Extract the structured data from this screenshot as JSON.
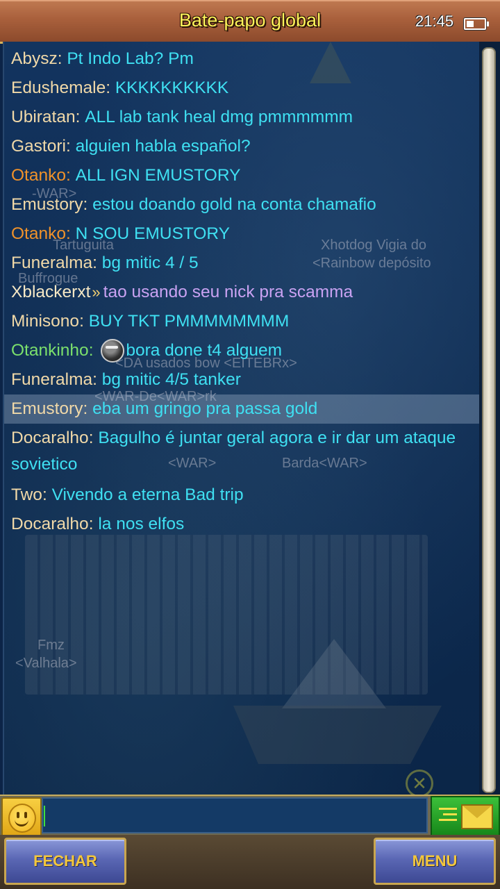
{
  "header": {
    "title": "Bate-papo global",
    "time": "21:45"
  },
  "background_names": [
    "-WAR>",
    "Tartuguita",
    "Xhotdog Vigia do",
    "<Rainbow depósito",
    "Buffrogue",
    "Barda<WAR>",
    "<WAR>",
    "Fmz",
    "<Valhala>",
    "<WAR-De<WAR>rk",
    "<DA usados bow <EITEBRx>"
  ],
  "messages": [
    {
      "sender": "Abysz",
      "sender_color": "default",
      "text": "Pt Indo Lab? Pm",
      "text_color": "cyan"
    },
    {
      "sender": "Edushemale",
      "sender_color": "default",
      "text": "KKKKKKKKKK",
      "text_color": "cyan"
    },
    {
      "sender": "Ubiratan",
      "sender_color": "default",
      "text": "ALL lab tank heal dmg pmmmmmm",
      "text_color": "cyan"
    },
    {
      "sender": "Gastori",
      "sender_color": "default",
      "text": "alguien habla español?",
      "text_color": "cyan"
    },
    {
      "sender": "Otanko",
      "sender_color": "orange",
      "text": "ALL IGN EMUSTORY",
      "text_color": "cyan"
    },
    {
      "sender": "Emustory",
      "sender_color": "default",
      "text": "estou  doando  gold  na conta  chamafio",
      "text_color": "cyan"
    },
    {
      "sender": "Otanko",
      "sender_color": "orange",
      "text": "N SOU EMUSTORY",
      "text_color": "cyan"
    },
    {
      "sender": "Funeralma",
      "sender_color": "default",
      "text": "bg mitic 4 / 5",
      "text_color": "cyan"
    },
    {
      "sender": "Xblackerxt",
      "sender_color": "cream",
      "text": "tao usando seu nick pra scamma",
      "text_color": "violet",
      "whisper": true
    },
    {
      "sender": "Minisono",
      "sender_color": "default",
      "text": "BUY TKT PMMMMMMMM",
      "text_color": "cyan"
    },
    {
      "sender": "Otankinho",
      "sender_color": "green",
      "text": "bora done t4 alguem",
      "text_color": "cyan",
      "emoji": true
    },
    {
      "sender": "Funeralma",
      "sender_color": "default",
      "text": "bg mitic 4/5 tanker",
      "text_color": "cyan"
    },
    {
      "sender": "Emustory",
      "sender_color": "default",
      "text": "eba um gringo  pra passa  gold",
      "text_color": "cyan",
      "highlight": true
    },
    {
      "sender": "Docaralho",
      "sender_color": "default",
      "text": "Bagulho é juntar geral agora e ir dar um ataque sovietico",
      "text_color": "cyan",
      "multi": true
    },
    {
      "sender": "Two",
      "sender_color": "default",
      "text": "Vivendo a eterna Bad trip",
      "text_color": "cyan"
    },
    {
      "sender": "Docaralho",
      "sender_color": "default",
      "text": "la nos elfos",
      "text_color": "cyan"
    }
  ],
  "input": {
    "value": "",
    "placeholder": ""
  },
  "buttons": {
    "close": "FECHAR",
    "menu": "MENU"
  },
  "icons": {
    "emoji": "smiley-icon",
    "send": "envelope-send-icon",
    "whisper": "double-chevron-icon",
    "battery": "battery-icon"
  },
  "colors": {
    "sender_default": "#f1d9a8",
    "sender_orange": "#f0922a",
    "sender_green": "#7be06c",
    "text_cyan": "#3fe0f2",
    "text_violet": "#c9a2f2",
    "title": "#fff35a"
  }
}
